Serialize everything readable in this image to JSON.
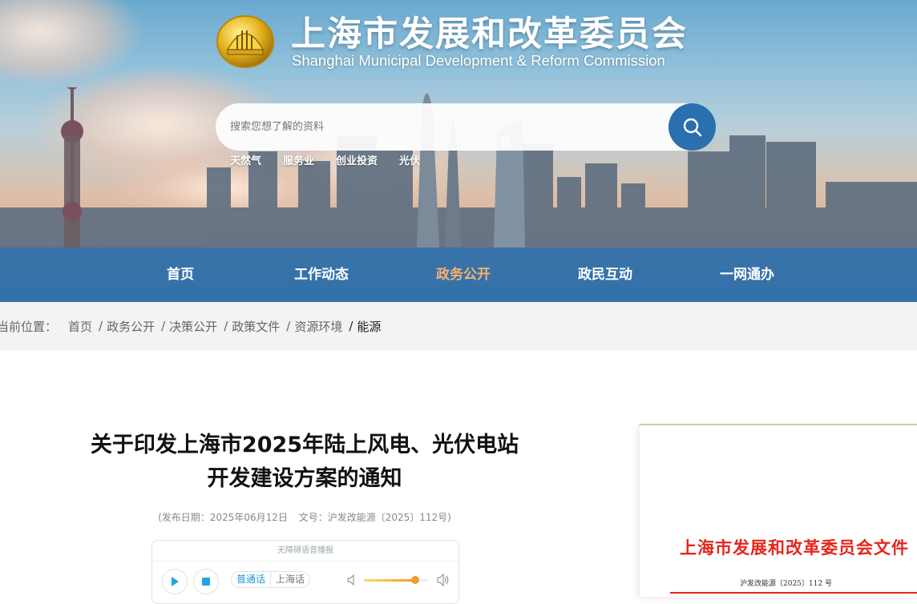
{
  "header": {
    "org_name_cn": "上海市发展和改革委员会",
    "org_name_en": "Shanghai Municipal Development & Reform Commission",
    "logo_icon": "emblem-icon"
  },
  "search": {
    "placeholder": "搜索您想了解的资料",
    "button_icon": "search-icon",
    "hot_words": [
      "天然气",
      "服务业",
      "创业投资",
      "光伏"
    ]
  },
  "nav": {
    "items": [
      {
        "label": "首页",
        "active": false
      },
      {
        "label": "工作动态",
        "active": false
      },
      {
        "label": "政务公开",
        "active": true
      },
      {
        "label": "政民互动",
        "active": false
      },
      {
        "label": "一网通办",
        "active": false
      }
    ],
    "active_color": "#f6b26b",
    "bar_color": "#2b6ca8"
  },
  "breadcrumb": {
    "label": "当前位置：",
    "items": [
      "首页",
      "政务公开",
      "决策公开",
      "政策文件",
      "资源环境"
    ],
    "current": "能源"
  },
  "article": {
    "title_line1": "关于印发上海市2025年陆上风电、光伏电站",
    "title_line2": "开发建设方案的通知",
    "publish_date": "(发布日期：2025年06月12日",
    "doc_number": "文号：沪发改能源〔2025〕112号)"
  },
  "player": {
    "heading": "无障碍语音播报",
    "play_icon": "play-icon",
    "stop_icon": "stop-icon",
    "lang_selected": "普通话",
    "lang_other": "上海话",
    "volume_level": 0.8
  },
  "document_preview": {
    "header": "上海市发展和改革委员会文件",
    "number": "沪发改能源〔2025〕112 号",
    "accent": "#e4271d"
  }
}
